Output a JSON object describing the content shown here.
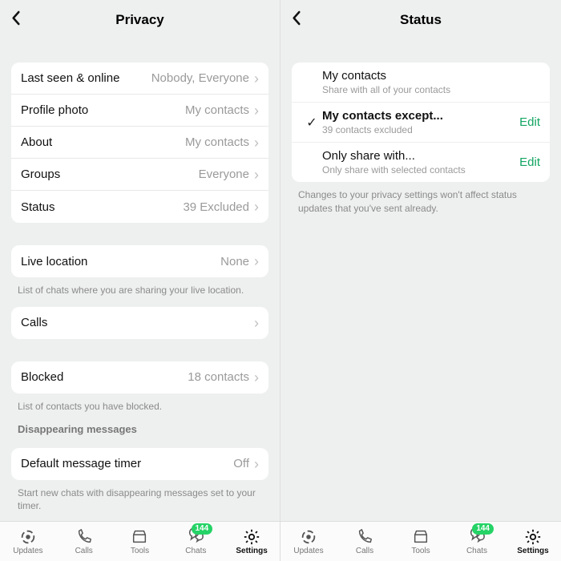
{
  "left": {
    "title": "Privacy",
    "group1": [
      {
        "label": "Last seen & online",
        "value": "Nobody, Everyone"
      },
      {
        "label": "Profile photo",
        "value": "My contacts"
      },
      {
        "label": "About",
        "value": "My contacts"
      },
      {
        "label": "Groups",
        "value": "Everyone"
      },
      {
        "label": "Status",
        "value": "39 Excluded"
      }
    ],
    "live_location": {
      "label": "Live location",
      "value": "None"
    },
    "live_location_note": "List of chats where you are sharing your live location.",
    "calls": {
      "label": "Calls",
      "value": ""
    },
    "blocked": {
      "label": "Blocked",
      "value": "18 contacts"
    },
    "blocked_note": "List of contacts you have blocked.",
    "disappearing_heading": "Disappearing messages",
    "timer": {
      "label": "Default message timer",
      "value": "Off"
    },
    "timer_note": "Start new chats with disappearing messages set to your timer."
  },
  "right": {
    "title": "Status",
    "options": [
      {
        "title": "My contacts",
        "sub": "Share with all of your contacts",
        "checked": false,
        "edit": false,
        "bold": false
      },
      {
        "title": "My contacts except...",
        "sub": "39 contacts excluded",
        "checked": true,
        "edit": true,
        "bold": true
      },
      {
        "title": "Only share with...",
        "sub": "Only share with selected contacts",
        "checked": false,
        "edit": true,
        "bold": false
      }
    ],
    "edit_label": "Edit",
    "note": "Changes to your privacy settings won't affect status updates that you've sent already."
  },
  "tabs": {
    "items": [
      "Updates",
      "Calls",
      "Tools",
      "Chats",
      "Settings"
    ],
    "chats_badge": "144",
    "active_index": 4
  }
}
